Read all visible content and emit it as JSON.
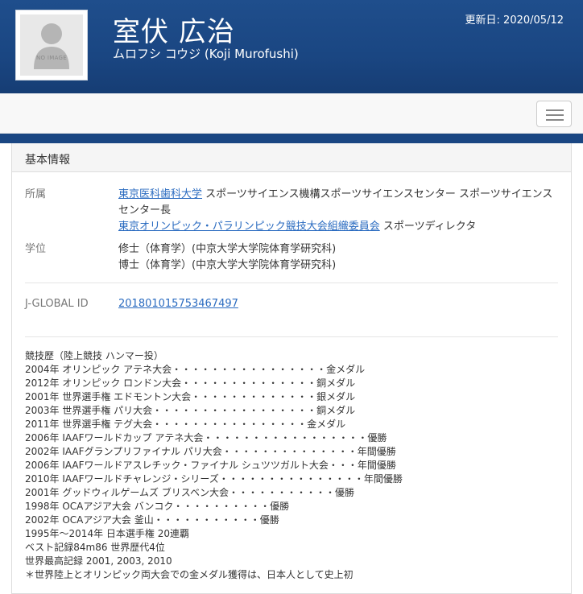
{
  "header": {
    "name_ja": "室伏 広治",
    "name_kana": "ムロフシ コウジ (Koji Murofushi)",
    "updated": "更新日: 2020/05/12",
    "avatar_text": "NO IMAGE"
  },
  "panel": {
    "heading": "基本情報",
    "affiliation_label": "所属",
    "affiliations": [
      {
        "org": "東京医科歯科大学",
        "title": "スポーツサイエンス機構スポーツサイエンスセンター スポーツサイエンスセンター長"
      },
      {
        "org": "東京オリンピック・パラリンピック競技大会組織委員会",
        "title": "スポーツディレクタ"
      }
    ],
    "degree_label": "学位",
    "degrees": [
      "修士（体育学）(中京大学大学院体育学研究科)",
      "博士（体育学）(中京大学大学院体育学研究科)"
    ],
    "jglobal_label": "J-GLOBAL ID",
    "jglobal_id": "201801015753467497"
  },
  "career": [
    "競技歴（陸上競技 ハンマー投）",
    "2004年 オリンピック アテネ大会・・・・・・・・・・・・・・・・金メダル",
    "2012年 オリンピック ロンドン大会・・・・・・・・・・・・・・銅メダル",
    "2001年 世界選手権 エドモントン大会・・・・・・・・・・・・・銀メダル",
    "2003年 世界選手権 パリ大会・・・・・・・・・・・・・・・・・銅メダル",
    "2011年 世界選手権 テグ大会・・・・・・・・・・・・・・・・金メダル",
    "2006年 IAAFワールドカップ アテネ大会・・・・・・・・・・・・・・・・・優勝",
    "2002年 IAAFグランプリファイナル パリ大会・・・・・・・・・・・・・・年間優勝",
    "2006年 IAAFワールドアスレチック・ファイナル シュツツガルト大会・・・年間優勝",
    "2010年 IAAFワールドチャレンジ・シリーズ・・・・・・・・・・・・・・・年間優勝",
    "2001年 グッドウィルゲームズ ブリスベン大会・・・・・・・・・・・優勝",
    "1998年 OCAアジア大会 バンコク・・・・・・・・・・優勝",
    "2002年 OCAアジア大会 釜山・・・・・・・・・・・優勝",
    "1995年～2014年 日本選手権 20連覇",
    "ベスト記録84m86 世界歴代4位",
    "世界最高記録 2001, 2003, 2010",
    "＊世界陸上とオリンピック両大会での金メダル獲得は、日本人として史上初"
  ]
}
